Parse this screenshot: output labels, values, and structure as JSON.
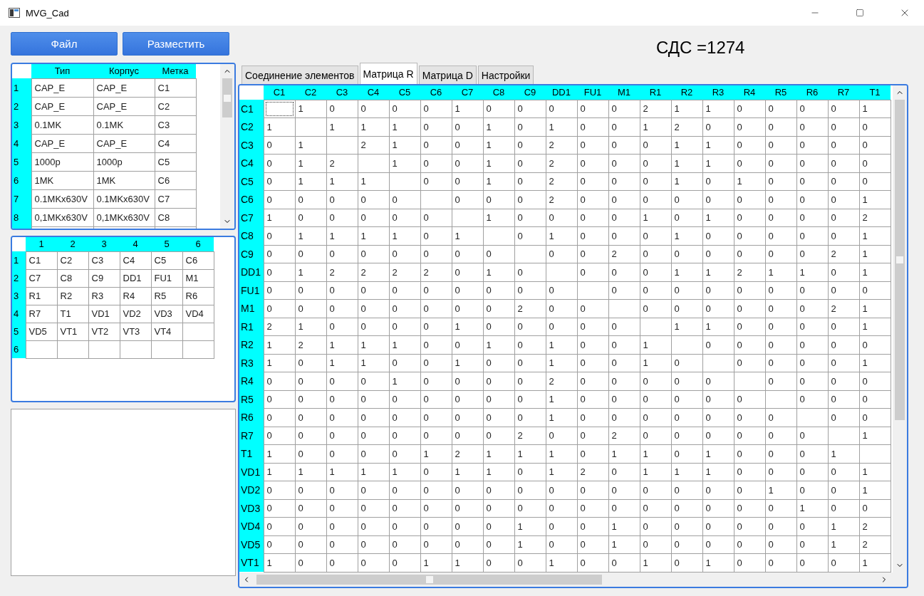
{
  "window": {
    "title": "MVG_Cad"
  },
  "buttons": [
    {
      "label": "Файл"
    },
    {
      "label": "Разместить"
    }
  ],
  "parts_table": {
    "columns": [
      "Тип",
      "Корпус",
      "Метка"
    ],
    "rows": [
      {
        "number": "1",
        "cells": [
          "CAP_E",
          "CAP_E",
          "C1"
        ]
      },
      {
        "number": "2",
        "cells": [
          "CAP_E",
          "CAP_E",
          "C2"
        ]
      },
      {
        "number": "3",
        "cells": [
          "0.1MK",
          "0.1MK",
          "C3"
        ]
      },
      {
        "number": "4",
        "cells": [
          "CAP_E",
          "CAP_E",
          "C4"
        ]
      },
      {
        "number": "5",
        "cells": [
          "1000p",
          "1000p",
          "C5"
        ]
      },
      {
        "number": "6",
        "cells": [
          "1MK",
          "1MK",
          "C6"
        ]
      },
      {
        "number": "7",
        "cells": [
          "0.1MKx630V",
          "0.1MKx630V",
          "C7"
        ]
      },
      {
        "number": "8",
        "cells": [
          "0,1MKx630V",
          "0,1MKx630V",
          "C8"
        ]
      }
    ]
  },
  "placement_grid": {
    "columns": [
      "1",
      "2",
      "3",
      "4",
      "5",
      "6"
    ],
    "rows": [
      {
        "number": "1",
        "cells": [
          "C1",
          "C2",
          "C3",
          "C4",
          "C5",
          "C6"
        ]
      },
      {
        "number": "2",
        "cells": [
          "C7",
          "C8",
          "C9",
          "DD1",
          "FU1",
          "M1"
        ]
      },
      {
        "number": "3",
        "cells": [
          "R1",
          "R2",
          "R3",
          "R4",
          "R5",
          "R6"
        ]
      },
      {
        "number": "4",
        "cells": [
          "R7",
          "T1",
          "VD1",
          "VD2",
          "VD3",
          "VD4"
        ]
      },
      {
        "number": "5",
        "cells": [
          "VD5",
          "VT1",
          "VT2",
          "VT3",
          "VT4",
          null
        ]
      },
      {
        "number": "6",
        "cells": [
          null,
          null,
          null,
          null,
          null,
          null
        ]
      }
    ]
  },
  "sds_label": "СДС =1274",
  "tabs": [
    {
      "label": "Соединение элементов",
      "selected": false
    },
    {
      "label": "Матрица R",
      "selected": true
    },
    {
      "label": "Матрица D",
      "selected": false
    },
    {
      "label": "Настройки",
      "selected": false
    }
  ],
  "matrix": {
    "columns": [
      "C1",
      "C2",
      "C3",
      "C4",
      "C5",
      "C6",
      "C7",
      "C8",
      "C9",
      "DD1",
      "FU1",
      "M1",
      "R1",
      "R2",
      "R3",
      "R4",
      "R5",
      "R6",
      "R7",
      "T1"
    ],
    "rows": [
      {
        "label": "C1",
        "cells": [
          null,
          "1",
          "0",
          "0",
          "0",
          "0",
          "1",
          "0",
          "0",
          "0",
          "0",
          "0",
          "2",
          "1",
          "1",
          "0",
          "0",
          "0",
          "0",
          "1"
        ]
      },
      {
        "label": "C2",
        "cells": [
          "1",
          null,
          "1",
          "1",
          "1",
          "0",
          "0",
          "1",
          "0",
          "1",
          "0",
          "0",
          "1",
          "2",
          "0",
          "0",
          "0",
          "0",
          "0",
          "0"
        ]
      },
      {
        "label": "C3",
        "cells": [
          "0",
          "1",
          null,
          "2",
          "1",
          "0",
          "0",
          "1",
          "0",
          "2",
          "0",
          "0",
          "0",
          "1",
          "1",
          "0",
          "0",
          "0",
          "0",
          "0"
        ]
      },
      {
        "label": "C4",
        "cells": [
          "0",
          "1",
          "2",
          null,
          "1",
          "0",
          "0",
          "1",
          "0",
          "2",
          "0",
          "0",
          "0",
          "1",
          "1",
          "0",
          "0",
          "0",
          "0",
          "0"
        ]
      },
      {
        "label": "C5",
        "cells": [
          "0",
          "1",
          "1",
          "1",
          null,
          "0",
          "0",
          "1",
          "0",
          "2",
          "0",
          "0",
          "0",
          "1",
          "0",
          "1",
          "0",
          "0",
          "0",
          "0"
        ]
      },
      {
        "label": "C6",
        "cells": [
          "0",
          "0",
          "0",
          "0",
          "0",
          null,
          "0",
          "0",
          "0",
          "2",
          "0",
          "0",
          "0",
          "0",
          "0",
          "0",
          "0",
          "0",
          "0",
          "1"
        ]
      },
      {
        "label": "C7",
        "cells": [
          "1",
          "0",
          "0",
          "0",
          "0",
          "0",
          null,
          "1",
          "0",
          "0",
          "0",
          "0",
          "1",
          "0",
          "1",
          "0",
          "0",
          "0",
          "0",
          "2"
        ]
      },
      {
        "label": "C8",
        "cells": [
          "0",
          "1",
          "1",
          "1",
          "1",
          "0",
          "1",
          null,
          "0",
          "1",
          "0",
          "0",
          "0",
          "1",
          "0",
          "0",
          "0",
          "0",
          "0",
          "1"
        ]
      },
      {
        "label": "C9",
        "cells": [
          "0",
          "0",
          "0",
          "0",
          "0",
          "0",
          "0",
          "0",
          null,
          "0",
          "0",
          "2",
          "0",
          "0",
          "0",
          "0",
          "0",
          "0",
          "2",
          "1"
        ]
      },
      {
        "label": "DD1",
        "cells": [
          "0",
          "1",
          "2",
          "2",
          "2",
          "2",
          "0",
          "1",
          "0",
          null,
          "0",
          "0",
          "0",
          "1",
          "1",
          "2",
          "1",
          "1",
          "0",
          "1"
        ]
      },
      {
        "label": "FU1",
        "cells": [
          "0",
          "0",
          "0",
          "0",
          "0",
          "0",
          "0",
          "0",
          "0",
          "0",
          null,
          "0",
          "0",
          "0",
          "0",
          "0",
          "0",
          "0",
          "0",
          "0"
        ]
      },
      {
        "label": "M1",
        "cells": [
          "0",
          "0",
          "0",
          "0",
          "0",
          "0",
          "0",
          "0",
          "2",
          "0",
          "0",
          null,
          "0",
          "0",
          "0",
          "0",
          "0",
          "0",
          "2",
          "1"
        ]
      },
      {
        "label": "R1",
        "cells": [
          "2",
          "1",
          "0",
          "0",
          "0",
          "0",
          "1",
          "0",
          "0",
          "0",
          "0",
          "0",
          null,
          "1",
          "1",
          "0",
          "0",
          "0",
          "0",
          "1"
        ]
      },
      {
        "label": "R2",
        "cells": [
          "1",
          "2",
          "1",
          "1",
          "1",
          "0",
          "0",
          "1",
          "0",
          "1",
          "0",
          "0",
          "1",
          null,
          "0",
          "0",
          "0",
          "0",
          "0",
          "0"
        ]
      },
      {
        "label": "R3",
        "cells": [
          "1",
          "0",
          "1",
          "1",
          "0",
          "0",
          "1",
          "0",
          "0",
          "1",
          "0",
          "0",
          "1",
          "0",
          null,
          "0",
          "0",
          "0",
          "0",
          "1"
        ]
      },
      {
        "label": "R4",
        "cells": [
          "0",
          "0",
          "0",
          "0",
          "1",
          "0",
          "0",
          "0",
          "0",
          "2",
          "0",
          "0",
          "0",
          "0",
          "0",
          null,
          "0",
          "0",
          "0",
          "0"
        ]
      },
      {
        "label": "R5",
        "cells": [
          "0",
          "0",
          "0",
          "0",
          "0",
          "0",
          "0",
          "0",
          "0",
          "1",
          "0",
          "0",
          "0",
          "0",
          "0",
          "0",
          null,
          "0",
          "0",
          "0"
        ]
      },
      {
        "label": "R6",
        "cells": [
          "0",
          "0",
          "0",
          "0",
          "0",
          "0",
          "0",
          "0",
          "0",
          "1",
          "0",
          "0",
          "0",
          "0",
          "0",
          "0",
          "0",
          null,
          "0",
          "0"
        ]
      },
      {
        "label": "R7",
        "cells": [
          "0",
          "0",
          "0",
          "0",
          "0",
          "0",
          "0",
          "0",
          "2",
          "0",
          "0",
          "2",
          "0",
          "0",
          "0",
          "0",
          "0",
          "0",
          null,
          "1"
        ]
      },
      {
        "label": "T1",
        "cells": [
          "1",
          "0",
          "0",
          "0",
          "0",
          "1",
          "2",
          "1",
          "1",
          "1",
          "0",
          "1",
          "1",
          "0",
          "1",
          "0",
          "0",
          "0",
          "1",
          null
        ]
      },
      {
        "label": "VD1",
        "cells": [
          "1",
          "1",
          "1",
          "1",
          "1",
          "0",
          "1",
          "1",
          "0",
          "1",
          "2",
          "0",
          "1",
          "1",
          "1",
          "0",
          "0",
          "0",
          "0",
          "1"
        ]
      },
      {
        "label": "VD2",
        "cells": [
          "0",
          "0",
          "0",
          "0",
          "0",
          "0",
          "0",
          "0",
          "0",
          "0",
          "0",
          "0",
          "0",
          "0",
          "0",
          "0",
          "1",
          "0",
          "0",
          "1"
        ]
      },
      {
        "label": "VD3",
        "cells": [
          "0",
          "0",
          "0",
          "0",
          "0",
          "0",
          "0",
          "0",
          "0",
          "0",
          "0",
          "0",
          "0",
          "0",
          "0",
          "0",
          "0",
          "1",
          "0",
          "0"
        ]
      },
      {
        "label": "VD4",
        "cells": [
          "0",
          "0",
          "0",
          "0",
          "0",
          "0",
          "0",
          "0",
          "1",
          "0",
          "0",
          "1",
          "0",
          "0",
          "0",
          "0",
          "0",
          "0",
          "1",
          "2"
        ]
      },
      {
        "label": "VD5",
        "cells": [
          "0",
          "0",
          "0",
          "0",
          "0",
          "0",
          "0",
          "0",
          "1",
          "0",
          "0",
          "1",
          "0",
          "0",
          "0",
          "0",
          "0",
          "0",
          "1",
          "2"
        ]
      },
      {
        "label": "VT1",
        "cells": [
          "1",
          "0",
          "0",
          "0",
          "0",
          "1",
          "1",
          "0",
          "0",
          "1",
          "0",
          "0",
          "1",
          "0",
          "1",
          "0",
          "0",
          "0",
          "0",
          "1"
        ]
      }
    ]
  }
}
